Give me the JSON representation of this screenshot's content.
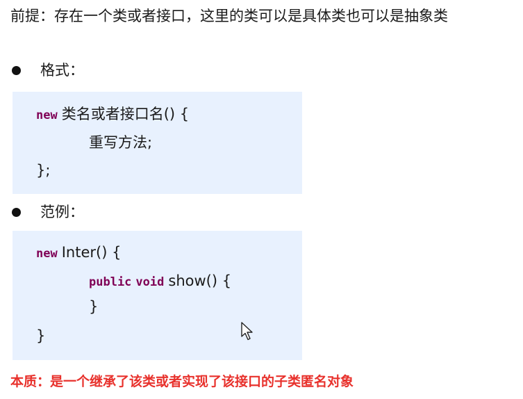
{
  "premise": "前提：存在一个类或者接口，这里的类可以是具体类也可以是抽象类",
  "format": {
    "label": "格式：",
    "line1_keyword": "new",
    "line1_rest": "类名或者接口名() {",
    "line2": "重写方法;",
    "line3": "};"
  },
  "example": {
    "label": "范例：",
    "line1_keyword": "new",
    "line1_rest": "Inter() {",
    "line2_kw1": "public",
    "line2_kw2": "void",
    "line2_rest": "show() {",
    "line3": "}",
    "line4": "}"
  },
  "essence": "本质：是一个继承了该类或者实现了该接口的子类匿名对象",
  "colors": {
    "keyword": "#7f0055",
    "code_background": "#e8f1fe",
    "essence_text": "#e8312c"
  },
  "icons": {
    "bullet": "filled-circle",
    "cursor": "mouse-pointer-arrow"
  }
}
